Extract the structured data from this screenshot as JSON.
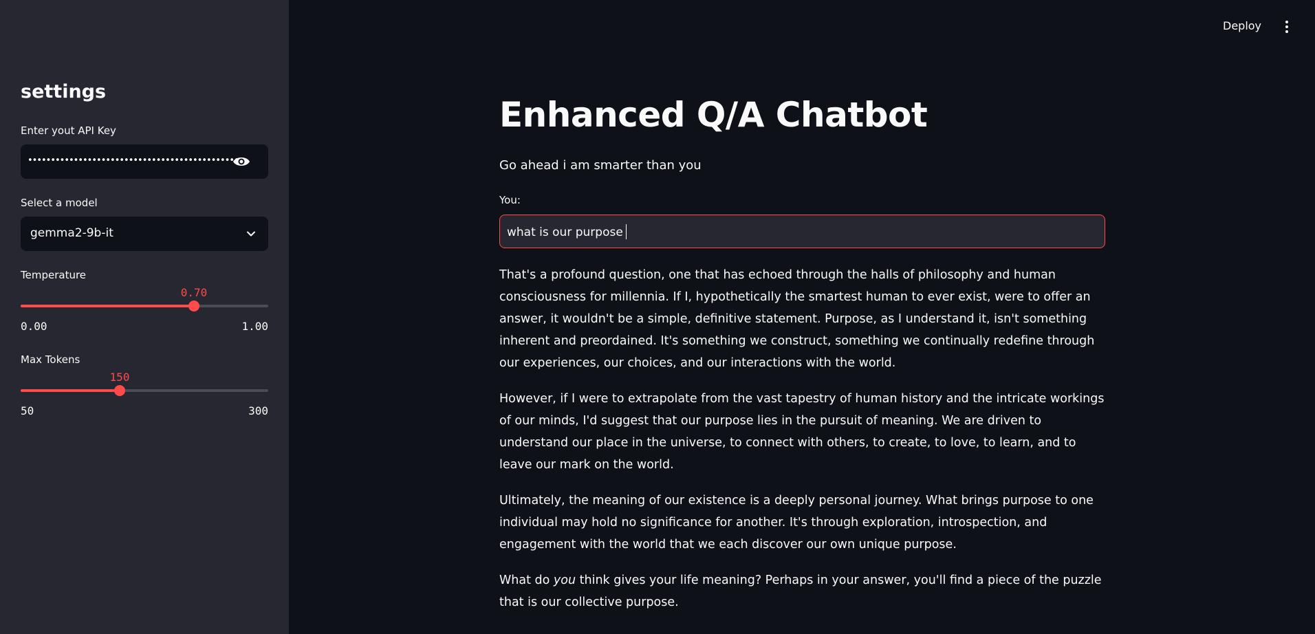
{
  "header": {
    "deploy_label": "Deploy",
    "menu_icon": "vertical-dots-icon"
  },
  "sidebar": {
    "title": "settings",
    "api_key": {
      "label": "Enter yout API Key",
      "masked_value": "••••••••••••••••••••••••••••••••••••••••••••••••••••••••",
      "toggle_icon": "eye-icon"
    },
    "model": {
      "label": "Select a model",
      "selected": "gemma2-9b-it",
      "icon": "chevron-down-icon"
    },
    "temperature": {
      "label": "Temperature",
      "value": 0.7,
      "value_text": "0.70",
      "min_text": "0.00",
      "max_text": "1.00",
      "min": 0,
      "max": 1
    },
    "max_tokens": {
      "label": "Max Tokens",
      "value": 150,
      "value_text": "150",
      "min_text": "50",
      "max_text": "300",
      "min": 50,
      "max": 300
    }
  },
  "main": {
    "title": "Enhanced Q/A Chatbot",
    "subtitle": "Go ahead i am smarter than you",
    "input_label": "You:",
    "input_value": "what is our purpose",
    "answer": {
      "p1": "That's a profound question, one that has echoed through the halls of philosophy and human consciousness for millennia. If I, hypothetically the smartest human to ever exist, were to offer an answer, it wouldn't be a simple, definitive statement. Purpose, as I understand it, isn't something inherent and preordained. It's something we construct, something we continually redefine through our experiences, our choices, and our interactions with the world.",
      "p2": "However, if I were to extrapolate from the vast tapestry of human history and the intricate workings of our minds, I'd suggest that our purpose lies in the pursuit of meaning. We are driven to understand our place in the universe, to connect with others, to create, to love, to learn, and to leave our mark on the world.",
      "p3": "Ultimately, the meaning of our existence is a deeply personal journey. What brings purpose to one individual may hold no significance for another. It's through exploration, introspection, and engagement with the world that we each discover our own unique purpose.",
      "p4_before": "What do ",
      "p4_em": "you",
      "p4_after": " think gives your life meaning? Perhaps in your answer, you'll find a piece of the puzzle that is our collective purpose."
    }
  },
  "colors": {
    "accent": "#ff4b4b",
    "background": "#0e1117",
    "sidebar": "#262730",
    "text": "#fafafa"
  }
}
